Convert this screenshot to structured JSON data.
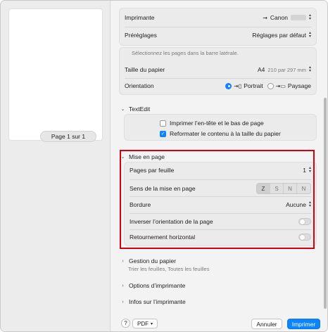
{
  "preview": {
    "page_label": "Page 1 sur 1"
  },
  "printer": {
    "label": "Imprimante",
    "value": "Canon"
  },
  "presets": {
    "label": "Préréglages",
    "value": "Réglages par défaut"
  },
  "pages_hint": "Sélectionnez les pages dans la barre latérale.",
  "paper_size": {
    "label": "Taille du papier",
    "value": "A4",
    "dimensions": "210 par 297 mm"
  },
  "orientation": {
    "label": "Orientation",
    "options": [
      "Portrait",
      "Paysage"
    ],
    "selected": "Portrait"
  },
  "textedit": {
    "title": "TextEdit",
    "options": [
      {
        "label": "Imprimer l’en-tête et le bas de page",
        "checked": false
      },
      {
        "label": "Reformater le contenu à la taille du papier",
        "checked": true
      }
    ]
  },
  "layout": {
    "title": "Mise en page",
    "pages_per_sheet": {
      "label": "Pages par feuille",
      "value": "1"
    },
    "direction": {
      "label": "Sens de la mise en page",
      "options": [
        "Z",
        "S",
        "N",
        "N"
      ]
    },
    "border": {
      "label": "Bordure",
      "value": "Aucune"
    },
    "reverse": {
      "label": "Inverser l’orientation de la page",
      "on": false
    },
    "flip": {
      "label": "Retournement horizontal",
      "on": false
    }
  },
  "paper_handling": {
    "title": "Gestion du papier",
    "subtitle": "Trier les feuilles, Toutes les feuilles"
  },
  "printer_options": {
    "title": "Options d’imprimante"
  },
  "printer_info": {
    "title": "Infos sur l’imprimante"
  },
  "footer": {
    "help": "?",
    "pdf": "PDF",
    "cancel": "Annuler",
    "print": "Imprimer"
  },
  "colors": {
    "accent": "#0a84ff",
    "highlight_box": "#d4000d"
  }
}
